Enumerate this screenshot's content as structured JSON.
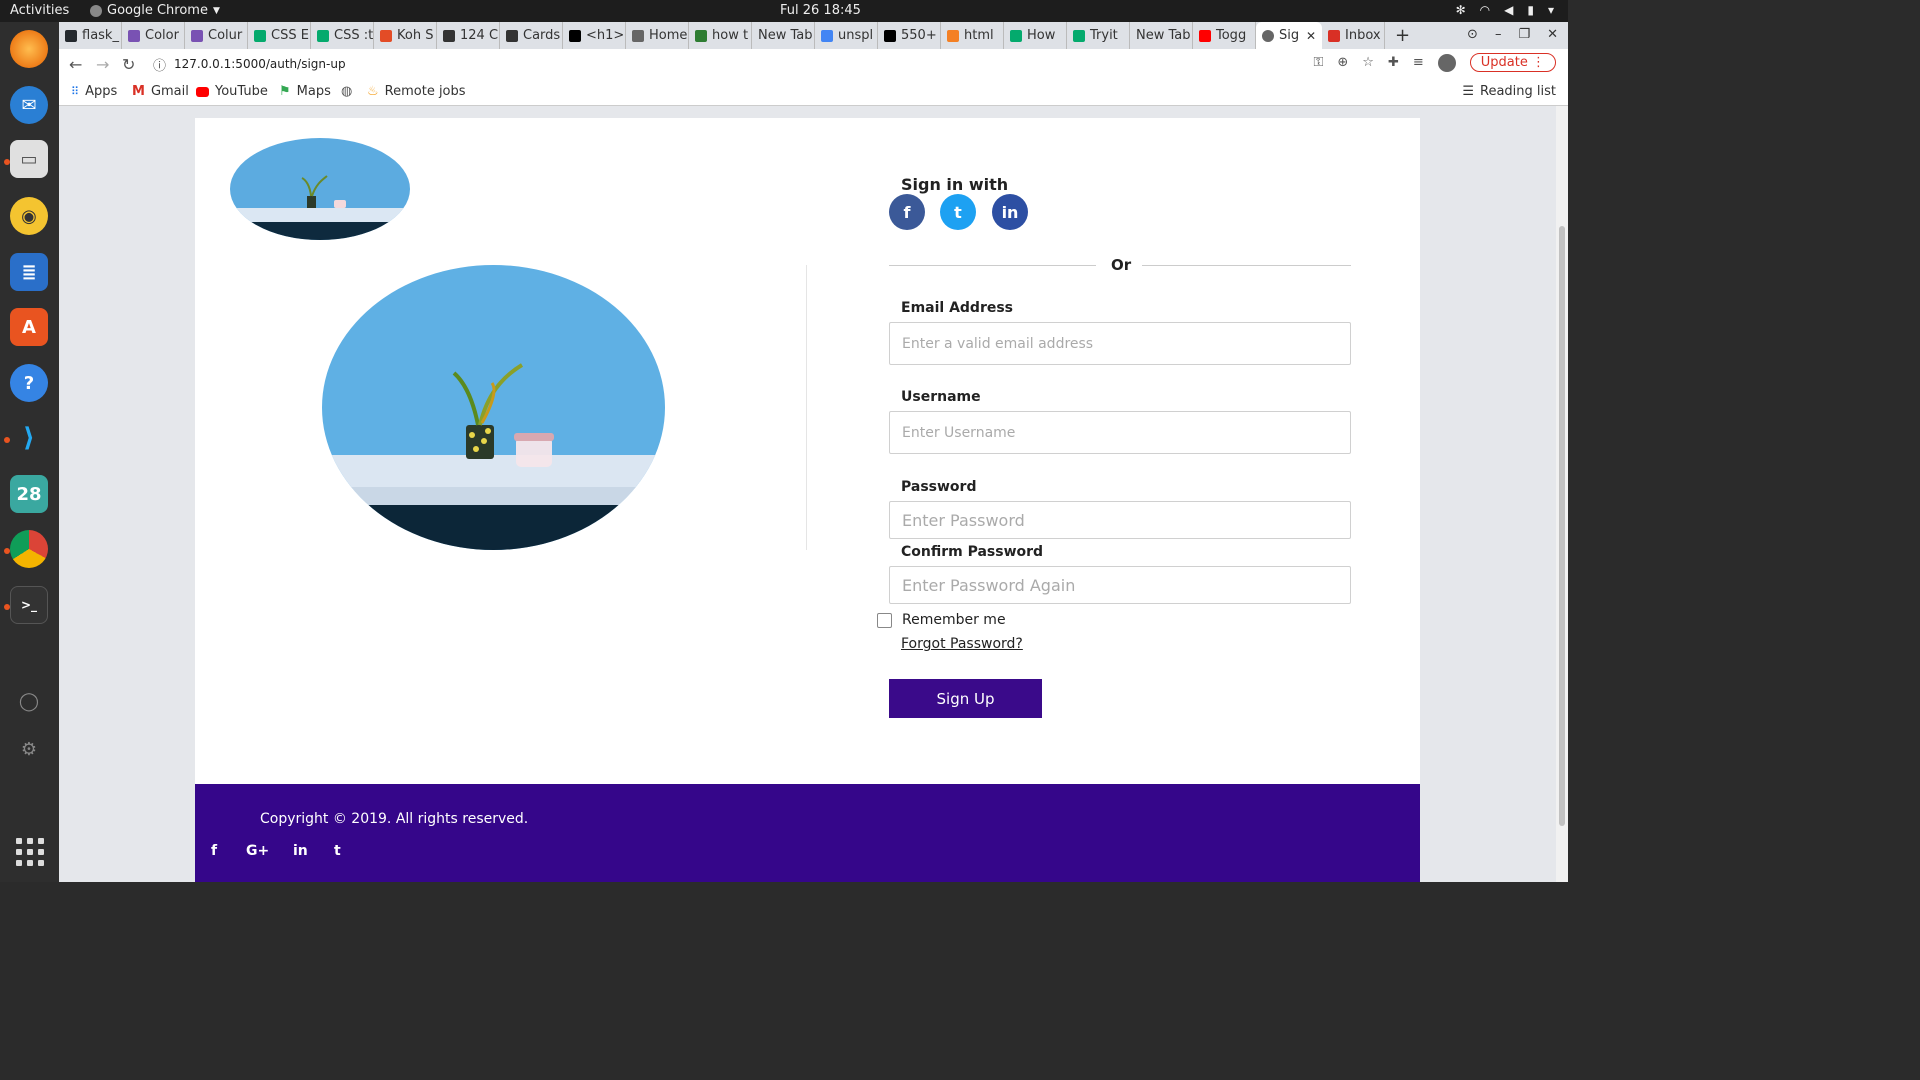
{
  "os": {
    "activities": "Activities",
    "app_name": "Google Chrome",
    "clock": "Ful 26  18:45"
  },
  "browser": {
    "tabs": [
      {
        "label": "flask_",
        "color": "#24292e"
      },
      {
        "label": "Color",
        "color": "#7952b3"
      },
      {
        "label": "Colur",
        "color": "#7952b3"
      },
      {
        "label": "CSS E",
        "color": "#04aa6d"
      },
      {
        "label": "CSS :t",
        "color": "#04aa6d"
      },
      {
        "label": "Koh S",
        "color": "#e34c26"
      },
      {
        "label": "124 C",
        "color": "#333333"
      },
      {
        "label": "Cards",
        "color": "#333333"
      },
      {
        "label": "<h1>",
        "color": "#000000"
      },
      {
        "label": "Home",
        "color": "#666666"
      },
      {
        "label": "how t",
        "color": "#2e7d32"
      },
      {
        "label": "New Tab",
        "color": ""
      },
      {
        "label": "unspl",
        "color": "#4285f4"
      },
      {
        "label": "550+",
        "color": "#000000"
      },
      {
        "label": "html",
        "color": "#f48024"
      },
      {
        "label": "How",
        "color": "#04aa6d"
      },
      {
        "label": "Tryit",
        "color": "#04aa6d"
      },
      {
        "label": "New Tab",
        "color": ""
      },
      {
        "label": "Togg",
        "color": "#ff0000"
      }
    ],
    "active_tab": {
      "label": "Sig",
      "color": "#666666"
    },
    "last_tab": {
      "label": "Inbox",
      "color": "#d93025"
    },
    "url": "127.0.0.1:5000/auth/sign-up",
    "update_label": "Update",
    "bookmarks": [
      {
        "label": "Apps",
        "icon": "apps-grid-icon"
      },
      {
        "label": "Gmail",
        "icon": "gmail-icon"
      },
      {
        "label": "YouTube",
        "icon": "youtube-icon"
      },
      {
        "label": "Maps",
        "icon": "maps-icon"
      },
      {
        "label": "",
        "icon": "globe-icon"
      },
      {
        "label": "Remote jobs",
        "icon": "remote-jobs-icon"
      }
    ],
    "reading_list": "Reading list"
  },
  "page": {
    "signin_with": "Sign in with",
    "social": [
      {
        "icon": "facebook-icon",
        "glyph": "f",
        "color": "#3b5998"
      },
      {
        "icon": "twitter-icon",
        "glyph": "t",
        "color": "#1da1f2"
      },
      {
        "icon": "linkedin-icon",
        "glyph": "in",
        "color": "#0e76a8"
      }
    ],
    "or_text": "Or",
    "email": {
      "label": "Email Address",
      "placeholder": "Enter a valid email address"
    },
    "username": {
      "label": "Username",
      "placeholder": "Enter Username"
    },
    "password": {
      "label": "Password",
      "placeholder": "Enter Password"
    },
    "confirm": {
      "label": "Confirm Password",
      "placeholder": "Enter Password Again"
    },
    "remember": "Remember me",
    "forgot": "Forgot Password?",
    "submit": "Sign Up",
    "accent": "#3a0a8a"
  },
  "footer": {
    "copyright": "Copyright © 2019. All rights reserved.",
    "icons": [
      "facebook-icon",
      "google-plus-icon",
      "linkedin-icon",
      "twitter-icon"
    ],
    "glyphs": [
      "f",
      "G+",
      "in",
      "t"
    ]
  }
}
